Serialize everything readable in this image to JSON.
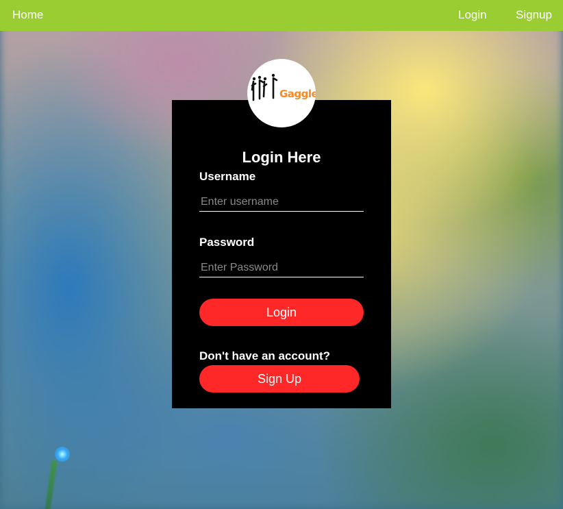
{
  "nav": {
    "home_label": "Home",
    "login_label": "Login",
    "signup_label": "Signup",
    "bar_color": "#9acd32"
  },
  "logo": {
    "text": "Gaggle",
    "text_color": "#f28c28"
  },
  "login_form": {
    "title": "Login Here",
    "username_label": "Username",
    "username_placeholder": "Enter username",
    "username_value": "",
    "password_label": "Password",
    "password_placeholder": "Enter Password",
    "password_value": "",
    "login_button": "Login",
    "no_account_text": "Don't have an account?",
    "signup_button": "Sign Up",
    "button_color": "#fe2828",
    "card_color": "#000000"
  }
}
